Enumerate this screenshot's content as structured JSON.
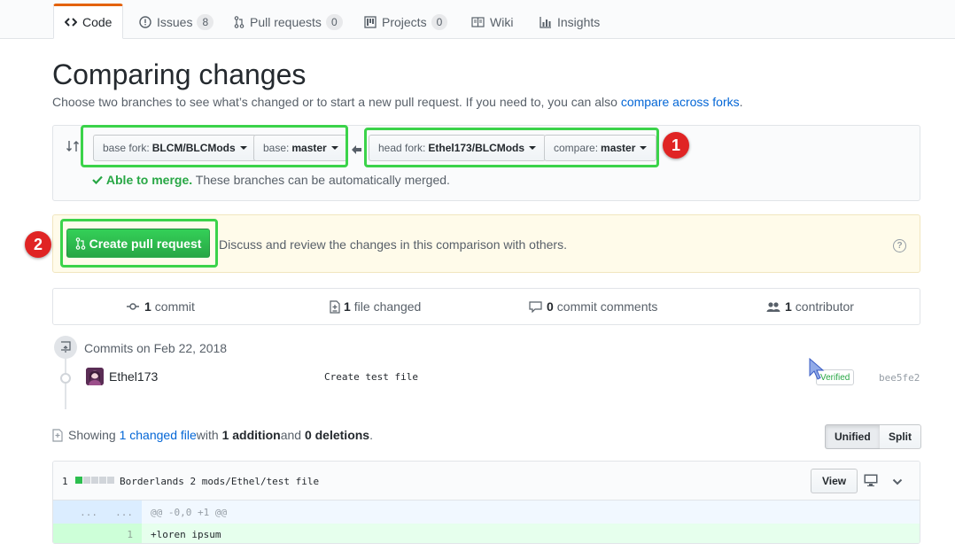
{
  "nav": {
    "tabs": [
      {
        "label": "Code",
        "icon": "code-icon",
        "selected": true
      },
      {
        "label": "Issues",
        "icon": "issue-icon",
        "count": "8"
      },
      {
        "label": "Pull requests",
        "icon": "pull-request-icon",
        "count": "0"
      },
      {
        "label": "Projects",
        "icon": "project-icon",
        "count": "0"
      },
      {
        "label": "Wiki",
        "icon": "book-icon"
      },
      {
        "label": "Insights",
        "icon": "graph-icon"
      }
    ]
  },
  "header": {
    "title": "Comparing changes",
    "subtitle": "Choose two branches to see what’s changed or to start a new pull request. If you need to, you can also ",
    "subtitle_link": "compare across forks",
    "subtitle_end": "."
  },
  "range": {
    "base_fork_label": "base fork:",
    "base_fork_value": "BLCM/BLCMods",
    "base_label": "base:",
    "base_value": "master",
    "head_fork_label": "head fork:",
    "head_fork_value": "Ethel173/BLCMods",
    "compare_label": "compare:",
    "compare_value": "master",
    "merge_ok": "Able to merge.",
    "merge_text": " These branches can be automatically merged."
  },
  "annotations": {
    "badge1": "1",
    "badge2": "2",
    "highlight_color": "#3bd34a",
    "badge_color": "#e02424"
  },
  "pr": {
    "button_label": "Create pull request",
    "description": "Discuss and review the changes in this comparison with others.",
    "help": "?"
  },
  "summary": {
    "commits_num": "1",
    "commits_label": "commit",
    "files_num": "1",
    "files_label": "file changed",
    "comments_num": "0",
    "comments_label": "commit comments",
    "contributors_num": "1",
    "contributors_label": "contributor"
  },
  "commits": {
    "date_heading": "Commits on Feb 22, 2018",
    "items": [
      {
        "author": "Ethel173",
        "message": "Create test file",
        "verified": "Verified",
        "sha": "bee5fe2"
      }
    ]
  },
  "toc": {
    "prefix": "Showing ",
    "link": "1 changed file",
    "mid1": " with ",
    "additions": "1 addition",
    "mid2": " and ",
    "deletions": "0 deletions",
    "end": ".",
    "unified": "Unified",
    "split": "Split"
  },
  "file": {
    "count": "1",
    "diffstat": {
      "additions": 1,
      "blocks": 5
    },
    "path": "Borderlands 2 mods/Ethel/test file",
    "view_label": "View",
    "hunk_left": "...",
    "hunk_right": "...",
    "hunk_header": "@@ -0,0 +1 @@",
    "line_num": "1",
    "line_code": "+loren ipsum"
  },
  "colors": {
    "accent": "#0366d6",
    "success": "#28a745",
    "tab_border": "#e36209"
  }
}
